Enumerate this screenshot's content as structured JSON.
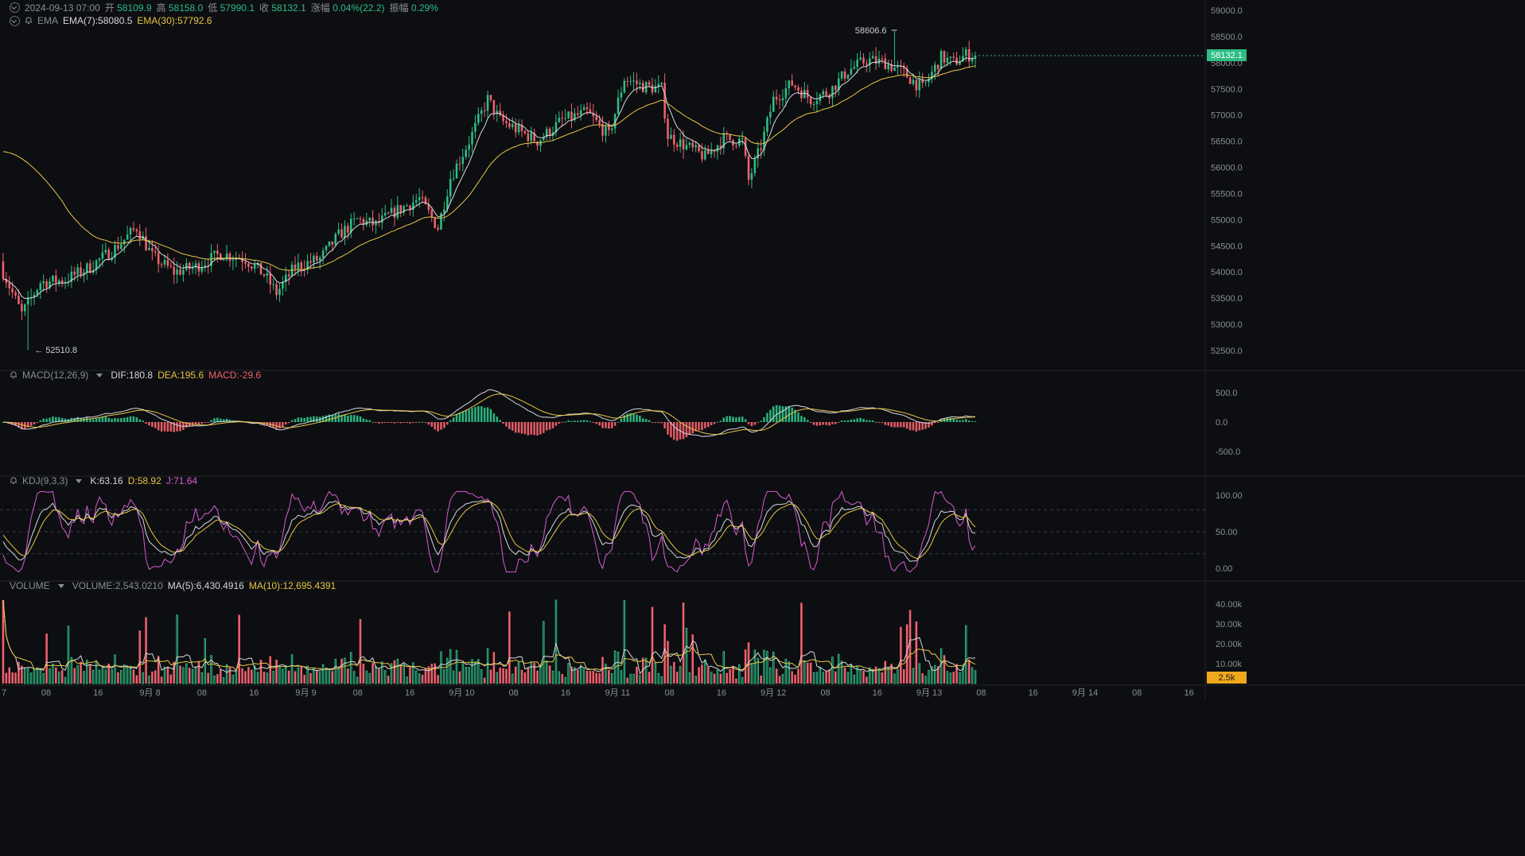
{
  "ohlc": {
    "datetime": "2024-09-13 07:00",
    "open_label": "开",
    "open": "58109.9",
    "high_label": "高",
    "high": "58158.0",
    "low_label": "低",
    "low": "57990.1",
    "close_label": "收",
    "close": "58132.1",
    "change_label": "涨幅",
    "change": "0.04%(22.2)",
    "amp_label": "振幅",
    "amp": "0.29%"
  },
  "ema": {
    "name": "EMA",
    "ema7": "EMA(7):58080.5",
    "ema30": "EMA(30):57792.6"
  },
  "macd": {
    "name": "MACD(12,26,9)",
    "dif": "DIF:180.8",
    "dea": "DEA:195.6",
    "macd": "MACD:-29.6"
  },
  "kdj": {
    "name": "KDJ(9,3,3)",
    "k": "K:63.16",
    "d": "D:58.92",
    "j": "J:71.64"
  },
  "volume": {
    "name": "VOLUME",
    "vol": "VOLUME:2,543.0210",
    "ma5": "MA(5):6,430.4916",
    "ma10": "MA(10):12,695.4391"
  },
  "price_axis": [
    "59000.0",
    "58500.0",
    "58000.0",
    "57500.0",
    "57000.0",
    "56500.0",
    "56000.0",
    "55500.0",
    "55000.0",
    "54500.0",
    "54000.0",
    "53500.0",
    "53000.0",
    "52500.0"
  ],
  "price_tag": "58132.1",
  "high_marker": "58606.6",
  "low_marker": "52510.8",
  "macd_axis": [
    "500.0",
    "0.0",
    "-500.0"
  ],
  "kdj_axis": [
    "100.00",
    "50.00",
    "0.00"
  ],
  "vol_axis": [
    "40.00k",
    "30.00k",
    "20.00k",
    "10.00k"
  ],
  "vol_tag": "2.5k",
  "time_axis": [
    "7",
    "08",
    "16",
    "9月 8",
    "08",
    "16",
    "9月 9",
    "08",
    "16",
    "9月 10",
    "08",
    "16",
    "9月 11",
    "08",
    "16",
    "9月 12",
    "08",
    "16",
    "9月 13",
    "08",
    "16",
    "9月 14",
    "08",
    "16"
  ],
  "colors": {
    "up": "#2ebd85",
    "down": "#f0616d",
    "ema7": "#d6d8dc",
    "ema30": "#e8c547",
    "kdj_j": "#d85ad1",
    "bg": "#0d0e11"
  },
  "chart_data": {
    "type": "candlestick",
    "x_range": [
      "2024-09-07",
      "2024-09-14"
    ],
    "y_range": [
      52200,
      59100
    ],
    "close_points": [
      [
        0,
        54000
      ],
      [
        6,
        53200
      ],
      [
        12,
        53800
      ],
      [
        20,
        53850
      ],
      [
        28,
        54100
      ],
      [
        36,
        54450
      ],
      [
        43,
        54850
      ],
      [
        48,
        54300
      ],
      [
        55,
        54000
      ],
      [
        62,
        54100
      ],
      [
        70,
        54350
      ],
      [
        78,
        54250
      ],
      [
        84,
        53950
      ],
      [
        88,
        53600
      ],
      [
        94,
        54100
      ],
      [
        102,
        54250
      ],
      [
        108,
        54700
      ],
      [
        114,
        55000
      ],
      [
        120,
        54900
      ],
      [
        126,
        55150
      ],
      [
        134,
        55400
      ],
      [
        140,
        54850
      ],
      [
        144,
        55800
      ],
      [
        150,
        56500
      ],
      [
        156,
        57300
      ],
      [
        160,
        56900
      ],
      [
        166,
        56700
      ],
      [
        172,
        56500
      ],
      [
        180,
        56900
      ],
      [
        188,
        57050
      ],
      [
        195,
        56600
      ],
      [
        200,
        57700
      ],
      [
        206,
        57550
      ],
      [
        212,
        57500
      ],
      [
        214,
        56600
      ],
      [
        220,
        56400
      ],
      [
        226,
        56200
      ],
      [
        232,
        56550
      ],
      [
        238,
        56500
      ],
      [
        240,
        55750
      ],
      [
        244,
        56400
      ],
      [
        248,
        57300
      ],
      [
        254,
        57600
      ],
      [
        260,
        57300
      ],
      [
        266,
        57450
      ],
      [
        272,
        57850
      ],
      [
        278,
        58050
      ],
      [
        284,
        58000
      ],
      [
        290,
        57800
      ],
      [
        296,
        57500
      ],
      [
        302,
        58100
      ],
      [
        306,
        58000
      ],
      [
        310,
        58150
      ],
      [
        313,
        58132
      ]
    ],
    "high_label": 58606.6,
    "low_label": 52510.8
  }
}
